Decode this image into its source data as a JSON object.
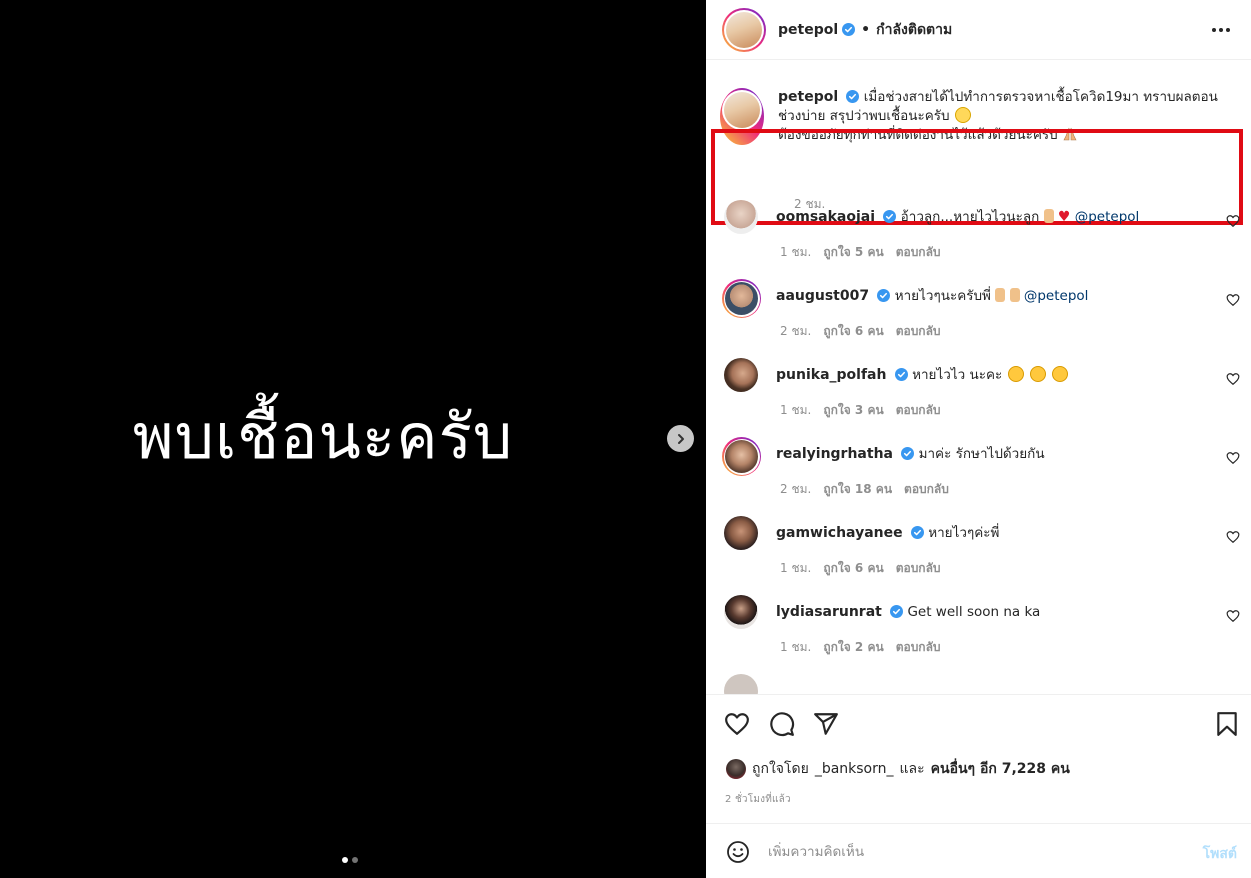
{
  "media": {
    "caption_text": "พบเชื้อนะครับ",
    "slide_count": 2,
    "active_slide": 1
  },
  "header": {
    "username": "petepol",
    "separator": "•",
    "follow_status": "กำลังติดตาม"
  },
  "caption": {
    "username": "petepol",
    "text_line1": "เมื่อช่วงสายได้ไปทำการตรวจหาเชื้อโควิด19มา ทราบผลตอนช่วงบ่าย สรุปว่าพบเชื้อนะครับ",
    "text_line2": "ต้องขออภัยทุกท่านที่ติดต่องานไว้แล้วด้วยนะครับ",
    "time": "2 ชม."
  },
  "comments": [
    {
      "username": "oomsakaojai",
      "text": "อ้าวลูก...หายไวไวนะลูก",
      "mention": "@petepol",
      "time": "1 ชม.",
      "likes": "ถูกใจ 5 คน",
      "reply": "ตอบกลับ",
      "avatar_color": "#d9c3b5"
    },
    {
      "username": "aaugust007",
      "text": "หายไวๆนะครับพี่",
      "mention": "@petepol",
      "time": "2 ชม.",
      "likes": "ถูกใจ 6 คน",
      "reply": "ตอบกลับ",
      "avatar_color": "#4a5b70"
    },
    {
      "username": "punika_polfah",
      "text": "หายไวไว นะคะ",
      "mention": "",
      "time": "1 ชม.",
      "likes": "ถูกใจ 3 คน",
      "reply": "ตอบกลับ",
      "avatar_color": "#5a4030"
    },
    {
      "username": "realyingrhatha",
      "text": "มาค่ะ รักษาไปด้วยกัน",
      "mention": "",
      "time": "2 ชม.",
      "likes": "ถูกใจ 18 คน",
      "reply": "ตอบกลับ",
      "avatar_color": "#7a5a4a"
    },
    {
      "username": "gamwichayanee",
      "text": "หายไวๆค่ะพี่",
      "mention": "",
      "time": "1 ชม.",
      "likes": "ถูกใจ 6 คน",
      "reply": "ตอบกลับ",
      "avatar_color": "#3a2a24"
    },
    {
      "username": "lydiasarunrat",
      "text": "Get well soon na ka",
      "mention": "",
      "time": "1 ชม.",
      "likes": "ถูกใจ 2 คน",
      "reply": "ตอบกลับ",
      "avatar_color": "#2a2020"
    }
  ],
  "footer": {
    "liked_by_prefix": "ถูกใจโดย",
    "liked_by_user": "_banksorn_",
    "liked_by_mid": "และ",
    "liked_by_others": "คนอื่นๆ อีก 7,228 คน",
    "post_time": "2 ชั่วโมงที่แล้ว",
    "comment_placeholder": "เพิ่มความคิดเห็น",
    "post_label": "โพสต์"
  },
  "colors": {
    "verified": "#3897f0",
    "highlight_border": "#e00b14",
    "post_button_disabled": "#b2dffc"
  }
}
